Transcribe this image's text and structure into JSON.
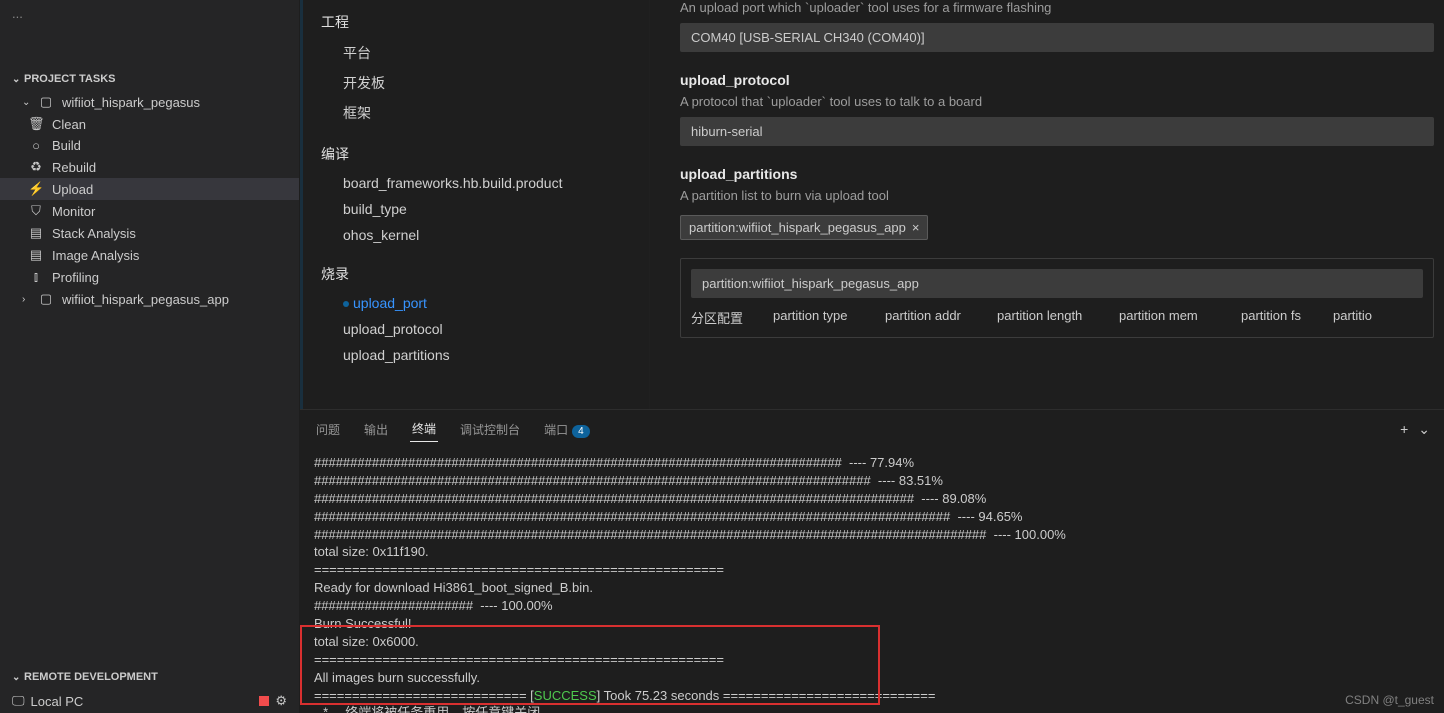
{
  "sidebar": {
    "project_tasks_title": "PROJECT TASKS",
    "project_name": "wifiiot_hispark_pegasus",
    "tasks": [
      {
        "icon": "🗑",
        "label": "Clean"
      },
      {
        "icon": "○",
        "label": "Build"
      },
      {
        "icon": "♻",
        "label": "Rebuild"
      },
      {
        "icon": "⚡",
        "label": "Upload"
      },
      {
        "icon": "⛉",
        "label": "Monitor"
      },
      {
        "icon": "▤",
        "label": "Stack Analysis"
      },
      {
        "icon": "▤",
        "label": "Image Analysis"
      },
      {
        "icon": "⫾",
        "label": "Profiling"
      }
    ],
    "project2": "wifiiot_hispark_pegasus_app",
    "remote_title": "REMOTE DEVELOPMENT",
    "local_pc": "Local PC"
  },
  "config": {
    "groups": [
      {
        "title": "工程",
        "items": [
          "平台",
          "开发板",
          "框架"
        ]
      },
      {
        "title": "编译",
        "items": [
          "board_frameworks.hb.build.product",
          "build_type",
          "ohos_kernel"
        ]
      },
      {
        "title": "烧录",
        "items": [
          "upload_port",
          "upload_protocol",
          "upload_partitions"
        ],
        "active": 0
      }
    ]
  },
  "form": {
    "upload_port": {
      "desc": "An upload port which `uploader` tool uses for a firmware flashing",
      "value": "COM40 [USB-SERIAL CH340 (COM40)]"
    },
    "upload_protocol": {
      "label": "upload_protocol",
      "desc": "A protocol that `uploader` tool uses to talk to a board",
      "value": "hiburn-serial"
    },
    "upload_partitions": {
      "label": "upload_partitions",
      "desc": "A partition list to burn via upload tool",
      "chip": "partition:wifiiot_hispark_pegasus_app",
      "input_value": "partition:wifiiot_hispark_pegasus_app",
      "table_headers": [
        "分区配置",
        "partition type",
        "partition addr",
        "partition length",
        "partition mem",
        "partition fs",
        "partitio"
      ]
    }
  },
  "terminal": {
    "tabs": {
      "problems": "问题",
      "output": "输出",
      "terminal": "终端",
      "debug": "调试控制台",
      "ports": "端口",
      "ports_badge": "4"
    },
    "lines": [
      "#########################################################################  ---- 77.94%",
      "#############################################################################  ---- 83.51%",
      "###################################################################################  ---- 89.08%",
      "########################################################################################  ---- 94.65%",
      "#############################################################################################  ---- 100.00%",
      "total size: 0x11f190.",
      "======================================================",
      "Ready for download Hi3861_boot_signed_B.bin.",
      "######################  ---- 100.00%",
      "Burn Successful!",
      "total size: 0x6000.",
      "======================================================",
      "All images burn successfully."
    ],
    "success_line_prefix": "============================ [",
    "success_word": "SUCCESS",
    "success_line_suffix": "] Took 75.23 seconds ============================",
    "reuse_msg": "终端将被任务重用，按任意键关闭。"
  },
  "watermark": "CSDN @t_guest"
}
